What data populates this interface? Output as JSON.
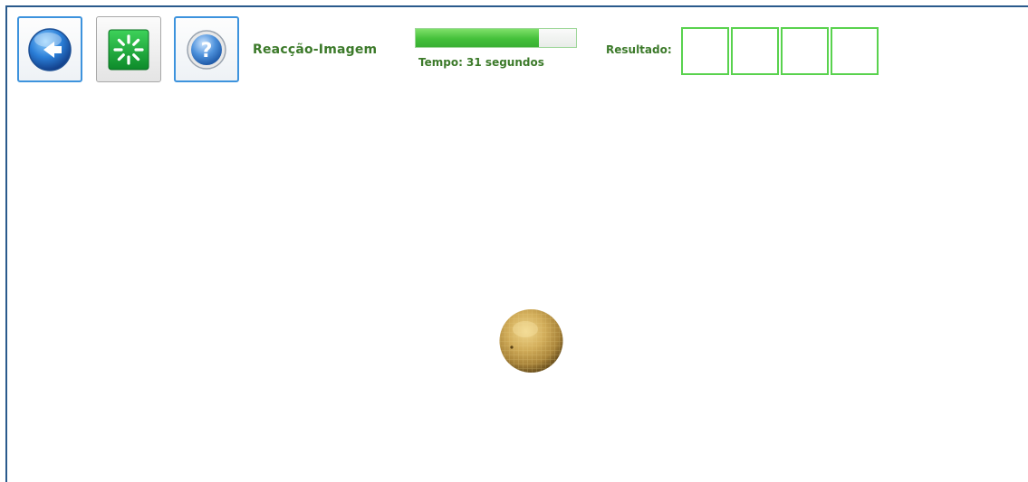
{
  "toolbar": {
    "back_icon": "back-arrow-icon",
    "restart_icon": "restart-spinner-icon",
    "help_icon": "help-question-icon",
    "help_glyph": "?"
  },
  "game": {
    "title": "Reacção-Imagem",
    "timer": {
      "text": "Tempo: 31 segundos",
      "progress_fraction": 0.77
    },
    "result": {
      "label": "Resultado:",
      "boxes": [
        "",
        "",
        "",
        ""
      ]
    },
    "target_image": "melon-fruit",
    "colors": {
      "accent_green": "#3c7a2a",
      "progress_green": "#44c03a",
      "box_border": "#59d24e",
      "frame_blue": "#2a5a8c"
    }
  }
}
